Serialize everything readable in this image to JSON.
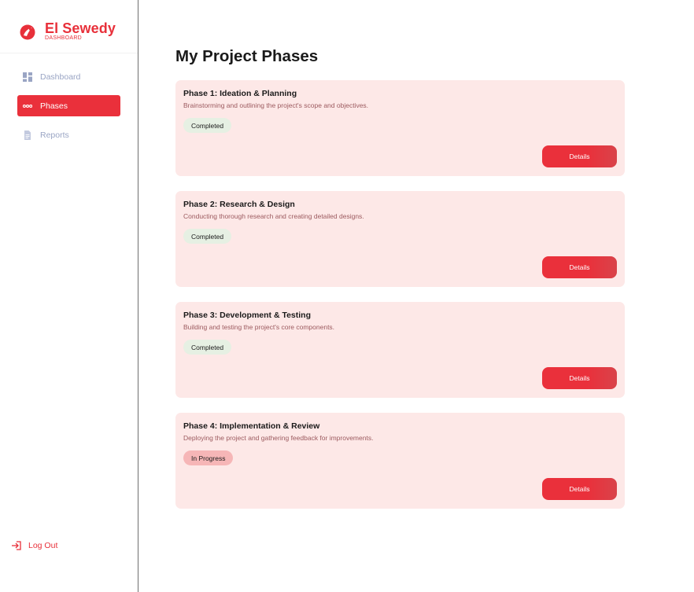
{
  "brand": {
    "name": "El Sewedy",
    "subtitle": "DASHBOARD",
    "color": "#e8303a"
  },
  "sidebar": {
    "items": [
      {
        "label": "Dashboard",
        "icon": "dashboard-grid-icon",
        "active": false
      },
      {
        "label": "Phases",
        "icon": "phases-dots-icon",
        "active": true
      },
      {
        "label": "Reports",
        "icon": "document-icon",
        "active": false
      }
    ],
    "logout_label": "Log Out"
  },
  "main": {
    "title": "My Project Phases",
    "phases": [
      {
        "title": "Phase 1: Ideation & Planning",
        "description": "Brainstorming and outlining the project's scope and objectives.",
        "status": "Completed",
        "button": "Details"
      },
      {
        "title": "Phase 2: Research & Design",
        "description": "Conducting thorough research and creating detailed designs.",
        "status": "Completed",
        "button": "Details"
      },
      {
        "title": "Phase 3: Development & Testing",
        "description": "Building and testing the project's core components.",
        "status": "Completed",
        "button": "Details"
      },
      {
        "title": "Phase 4: Implementation & Review",
        "description": "Deploying the project and gathering feedback for improvements.",
        "status": "In Progress",
        "button": "Details"
      }
    ]
  },
  "colors": {
    "accent": "#ea303b",
    "card_bg": "#fde8e7",
    "completed_badge": "#e6f0e3",
    "in_progress_badge": "#f6b6b7",
    "nav_inactive": "#9aa5c4"
  }
}
